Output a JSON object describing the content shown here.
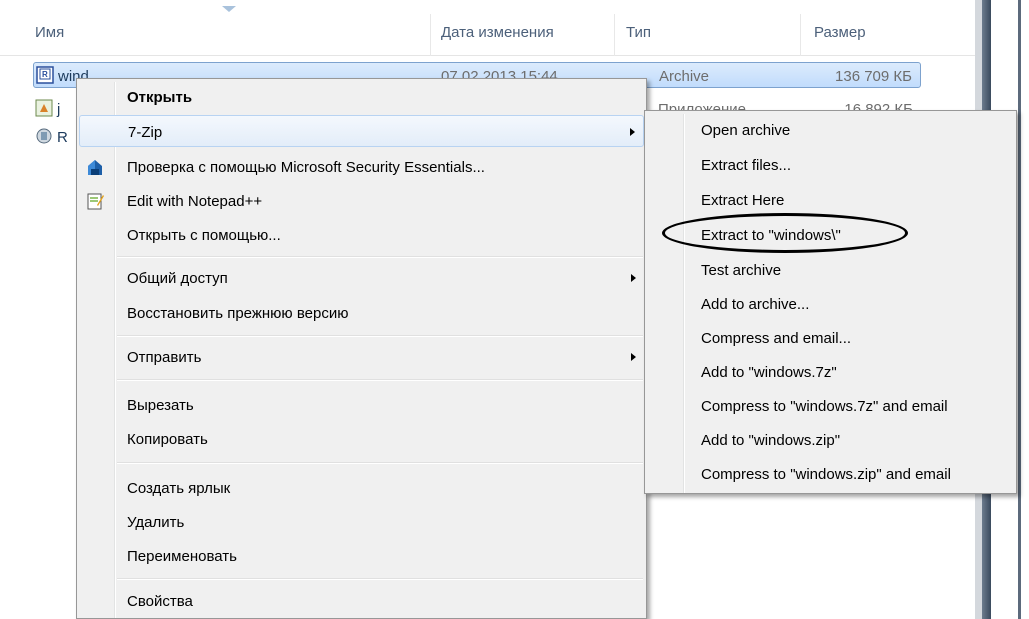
{
  "columns": {
    "name": "Имя",
    "date": "Дата изменения",
    "type": "Тип",
    "size": "Размер"
  },
  "files": [
    {
      "name": "wind",
      "date": "07.02.2013 15:44",
      "type": "Archive",
      "size": "136 709 КБ",
      "icon": "rar-archive-icon",
      "selected": true
    },
    {
      "name": "j",
      "date": "",
      "type": "Приложение",
      "size": "16 892 КБ",
      "icon": "java-installer-icon",
      "selected": false
    },
    {
      "name": "R",
      "date": "",
      "type": "",
      "size": "",
      "icon": "r-program-icon",
      "selected": false
    }
  ],
  "context_menu": {
    "items": [
      {
        "label": "Открыть",
        "bold": true
      },
      {
        "label": "7-Zip",
        "submenu": true,
        "hover": true
      },
      {
        "label": "Проверка с помощью Microsoft Security Essentials...",
        "icon": "security-essentials-icon"
      },
      {
        "label": "Edit with Notepad++",
        "icon": "notepad-plus-plus-icon"
      },
      {
        "label": "Открыть с помощью..."
      },
      {
        "label": "Общий доступ",
        "submenu": true
      },
      {
        "label": "Восстановить прежнюю версию"
      },
      {
        "label": "Отправить",
        "submenu": true
      },
      {
        "label": "Вырезать"
      },
      {
        "label": "Копировать"
      },
      {
        "label": "Создать ярлык"
      },
      {
        "label": "Удалить"
      },
      {
        "label": "Переименовать"
      },
      {
        "label": "Свойства"
      }
    ]
  },
  "zip_submenu": {
    "items": [
      {
        "label": "Open archive"
      },
      {
        "label": "Extract files..."
      },
      {
        "label": "Extract Here"
      },
      {
        "label": "Extract to \"windows\\\"",
        "highlighted_annotation": true
      },
      {
        "label": "Test archive"
      },
      {
        "label": "Add to archive..."
      },
      {
        "label": "Compress and email..."
      },
      {
        "label": "Add to \"windows.7z\""
      },
      {
        "label": "Compress to \"windows.7z\" and email"
      },
      {
        "label": "Add to \"windows.zip\""
      },
      {
        "label": "Compress to \"windows.zip\" and email"
      }
    ]
  },
  "colors": {
    "menu_bg": "#f0f0f0",
    "hover_border": "#b8d3f2",
    "selection_border": "#7da2ce",
    "header_text": "#4c607a"
  }
}
